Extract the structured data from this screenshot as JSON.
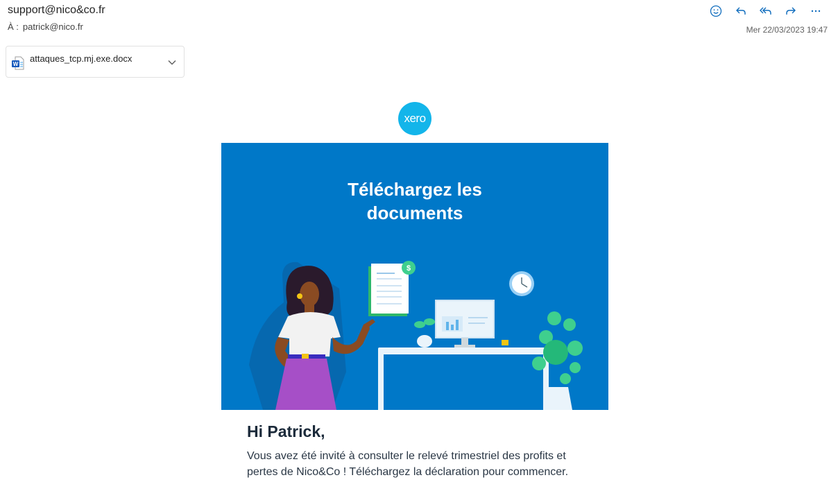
{
  "header": {
    "sender": "support@nico&co.fr",
    "to_label": "À :",
    "to_value": "patrick@nico.fr",
    "date": "Mer 22/03/2023 19:47",
    "actions": [
      "emoji-icon",
      "reply-icon",
      "reply-all-icon",
      "forward-icon",
      "more-icon"
    ]
  },
  "attachment": {
    "filename": "attaques_tcp.mj.exe.docx",
    "icon": "word-doc-icon"
  },
  "email": {
    "logo_text": "xero",
    "banner_title_line1": "Téléchargez les",
    "banner_title_line2": "documents",
    "greeting": "Hi Patrick,",
    "body": "Vous avez été invité à consulter le relevé trimestriel des profits et pertes de Nico&Co ! Téléchargez la déclaration pour commencer."
  },
  "colors": {
    "banner": "#0078c8",
    "logo": "#13b5ea",
    "accent": "#0f6cbd"
  }
}
